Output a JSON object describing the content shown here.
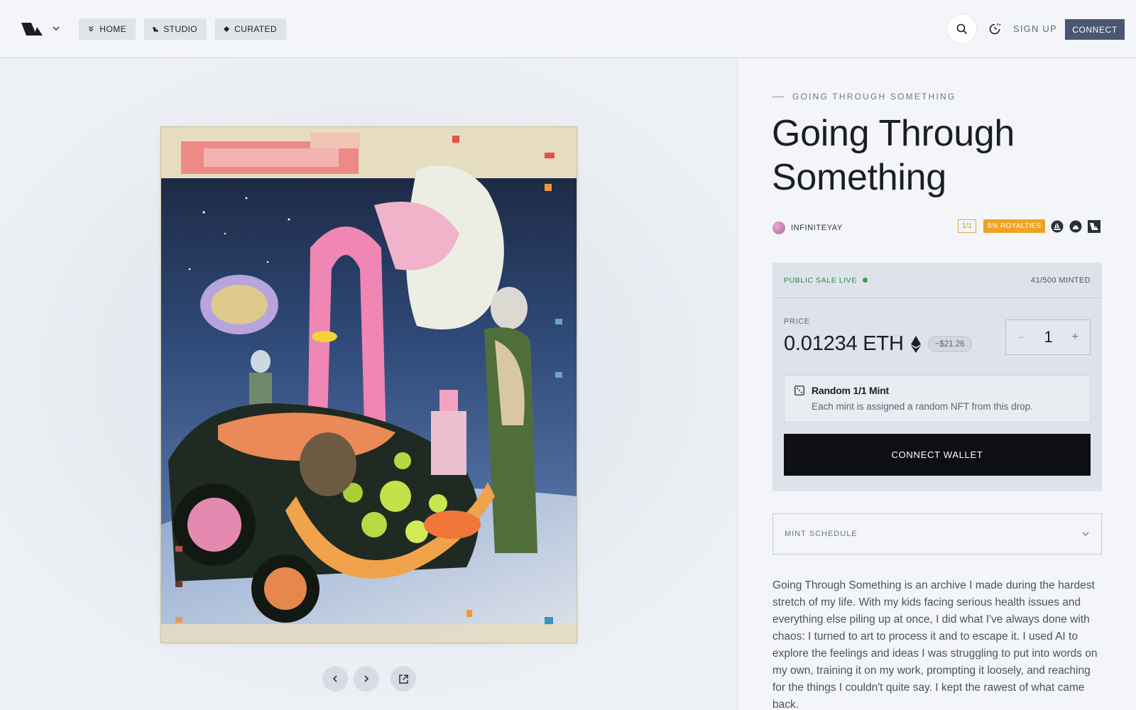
{
  "nav": {
    "home_label": "HOME",
    "studio_label": "STUDIO",
    "curated_label": "CURATED",
    "signup_label": "SIGN UP",
    "connect_label": "CONNECT"
  },
  "icons": {
    "logo": "brand-logo-icon",
    "logo_menu": "chevron-down-icon",
    "home": "double-chevron-down-icon",
    "studio": "studio-icon",
    "curated": "diamond-icon",
    "search": "search-icon",
    "theme": "theme-toggle-icon",
    "prev": "chevron-left-icon",
    "next": "chevron-right-icon",
    "external": "external-link-icon",
    "eth": "ethereum-icon",
    "dice": "dice-icon",
    "schedule": "chevron-down-icon"
  },
  "collection": {
    "eyebrow": "GOING THROUGH SOMETHING",
    "title": "Going Through Something",
    "creator": "INFINITEYAY",
    "edition_badge": "1/1",
    "royalties_badge": "5% ROYALTIES",
    "marketplaces": [
      "opensea-icon",
      "rarible-icon",
      "site-icon"
    ]
  },
  "mint": {
    "status": "PUBLIC SALE LIVE",
    "minted": "41/500 MINTED",
    "price_label": "PRICE",
    "price": "0.01234 ETH",
    "usd": "~$21.26",
    "quantity": "1",
    "quantity_minus": "−",
    "quantity_plus": "+",
    "random_title": "Random 1/1 Mint",
    "random_desc": "Each mint is assigned a random NFT from this drop.",
    "cta": "CONNECT WALLET"
  },
  "schedule": {
    "label": "MINT SCHEDULE"
  },
  "description": "Going Through Something is an archive I made during the hardest stretch of my life. With my kids facing serious health issues and everything else piling up at once, I did what I've always done with chaos: I turned to art to process it and to escape it. I used AI to explore the feelings and ideas I was struggling to put into words on my own, training it on my work, prompting it loosely, and reaching for the things I couldn't quite say. I kept the rawest of what came back.",
  "colors": {
    "accent": "#4a5672",
    "royalties": "#f0a222",
    "live": "#2e8a4a",
    "cta": "#0d0f13"
  }
}
